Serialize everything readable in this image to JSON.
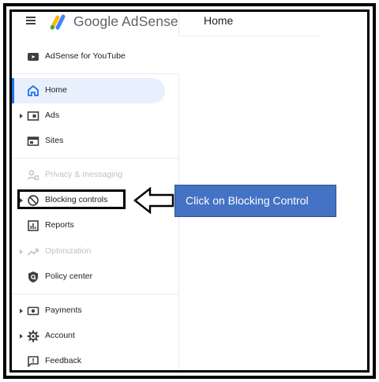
{
  "header": {
    "brand": "Google AdSense",
    "page_title": "Home"
  },
  "sidebar": {
    "items": [
      {
        "label": "AdSense for YouTube",
        "icon": "youtube-icon",
        "muted": false,
        "caret": false,
        "active": false
      },
      {
        "label": "Home",
        "icon": "home-icon",
        "muted": false,
        "caret": false,
        "active": true
      },
      {
        "label": "Ads",
        "icon": "ads-icon",
        "muted": false,
        "caret": true,
        "active": false
      },
      {
        "label": "Sites",
        "icon": "sites-icon",
        "muted": false,
        "caret": false,
        "active": false
      },
      {
        "label": "Privacy & messaging",
        "icon": "privacy-icon",
        "muted": true,
        "caret": false,
        "active": false
      },
      {
        "label": "Blocking controls",
        "icon": "block-icon",
        "muted": false,
        "caret": true,
        "active": false
      },
      {
        "label": "Reports",
        "icon": "reports-icon",
        "muted": false,
        "caret": false,
        "active": false
      },
      {
        "label": "Optimization",
        "icon": "optimization-icon",
        "muted": true,
        "caret": true,
        "active": false
      },
      {
        "label": "Policy center",
        "icon": "policy-icon",
        "muted": false,
        "caret": false,
        "active": false
      },
      {
        "label": "Payments",
        "icon": "payments-icon",
        "muted": false,
        "caret": true,
        "active": false
      },
      {
        "label": "Account",
        "icon": "gear-icon",
        "muted": false,
        "caret": true,
        "active": false
      },
      {
        "label": "Feedback",
        "icon": "feedback-icon",
        "muted": false,
        "caret": false,
        "active": false
      }
    ]
  },
  "annotation": {
    "callout_text": "Click on Blocking Control"
  },
  "colors": {
    "accent": "#1a73e8",
    "active_bg": "#e8f0fe",
    "callout_bg": "#4472c4",
    "muted_text": "#bdc1c6"
  }
}
